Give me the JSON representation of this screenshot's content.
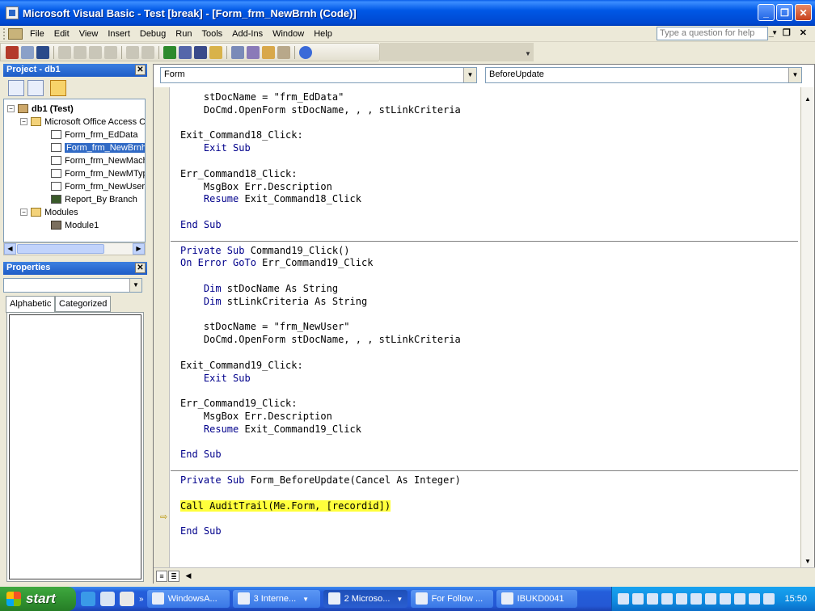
{
  "window": {
    "title": "Microsoft Visual Basic - Test [break] - [Form_frm_NewBrnh (Code)]"
  },
  "menu": {
    "items": [
      "File",
      "Edit",
      "View",
      "Insert",
      "Debug",
      "Run",
      "Tools",
      "Add-Ins",
      "Window",
      "Help"
    ],
    "help_placeholder": "Type a question for help"
  },
  "project": {
    "title": "Project - db1",
    "root": "db1 (Test)",
    "folder_objects": "Microsoft Office Access Class Objects",
    "items": [
      "Form_frm_EdData",
      "Form_frm_NewBrnh",
      "Form_frm_NewMachine",
      "Form_frm_NewMType",
      "Form_frm_NewUser",
      "Report_By Branch"
    ],
    "selected": "Form_frm_NewBrnh",
    "folder_modules": "Modules",
    "modules": [
      "Module1"
    ]
  },
  "properties": {
    "title": "Properties",
    "tabs": [
      "Alphabetic",
      "Categorized"
    ]
  },
  "code": {
    "object_combo": "Form",
    "procedure_combo": "BeforeUpdate",
    "lines": [
      {
        "kw": "",
        "text": "    stDocName = \"frm_EdData\""
      },
      {
        "kw": "",
        "text": "    DoCmd.OpenForm stDocName, , , stLinkCriteria"
      },
      {
        "kw": "",
        "text": ""
      },
      {
        "kw": "",
        "text": "Exit_Command18_Click:"
      },
      {
        "kw": "    Exit Sub",
        "text": ""
      },
      {
        "kw": "",
        "text": ""
      },
      {
        "kw": "",
        "text": "Err_Command18_Click:"
      },
      {
        "kw": "",
        "text": "    MsgBox Err.Description"
      },
      {
        "kw": "    Resume",
        "text": " Exit_Command18_Click"
      },
      {
        "kw": "",
        "text": ""
      },
      {
        "kw": "End Sub",
        "text": ""
      },
      {
        "kw": "",
        "text": ""
      },
      {
        "kw": "Private Sub",
        "text": " Command19_Click()"
      },
      {
        "kw": "On Error GoTo",
        "text": " Err_Command19_Click"
      },
      {
        "kw": "",
        "text": ""
      },
      {
        "kw": "    Dim",
        "text": " stDocName As String"
      },
      {
        "kw": "    Dim",
        "text": " stLinkCriteria As String"
      },
      {
        "kw": "",
        "text": ""
      },
      {
        "kw": "",
        "text": "    stDocName = \"frm_NewUser\""
      },
      {
        "kw": "",
        "text": "    DoCmd.OpenForm stDocName, , , stLinkCriteria"
      },
      {
        "kw": "",
        "text": ""
      },
      {
        "kw": "",
        "text": "Exit_Command19_Click:"
      },
      {
        "kw": "    Exit Sub",
        "text": ""
      },
      {
        "kw": "",
        "text": ""
      },
      {
        "kw": "",
        "text": "Err_Command19_Click:"
      },
      {
        "kw": "",
        "text": "    MsgBox Err.Description"
      },
      {
        "kw": "    Resume",
        "text": " Exit_Command19_Click"
      },
      {
        "kw": "",
        "text": ""
      },
      {
        "kw": "End Sub",
        "text": ""
      },
      {
        "kw": "",
        "text": ""
      },
      {
        "kw": "Private Sub",
        "text": " Form_BeforeUpdate(Cancel As Integer)"
      },
      {
        "kw": "",
        "text": ""
      },
      {
        "kw": "",
        "text": "Call AuditTrail(Me.Form, [recordid])",
        "highlight": true
      },
      {
        "kw": "",
        "text": ""
      },
      {
        "kw": "End Sub",
        "text": ""
      }
    ]
  },
  "taskbar": {
    "start": "start",
    "tasks": [
      "WindowsA...",
      "3 Interne...",
      "2 Microso...",
      "For Follow ...",
      "IBUKD0041"
    ],
    "clock": "15:50"
  }
}
